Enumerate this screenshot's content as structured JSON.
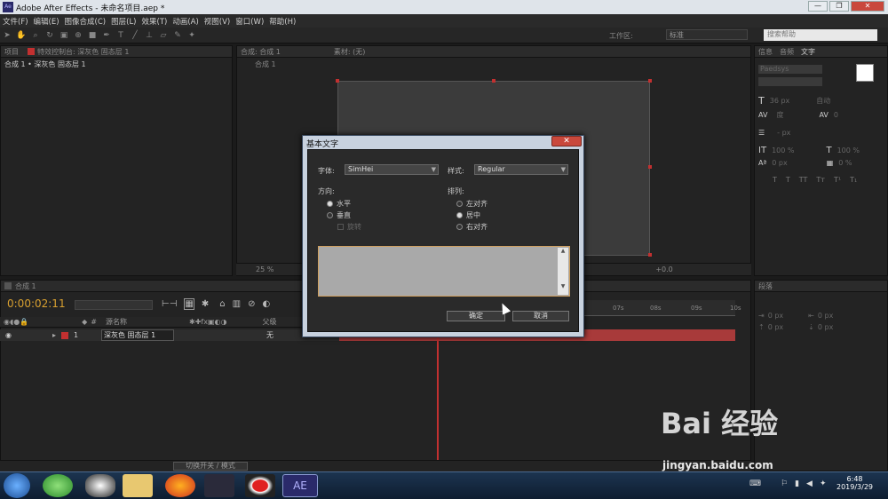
{
  "window": {
    "title": "Adobe After Effects - 未命名项目.aep *",
    "minimize": "—",
    "maximize": "❐",
    "close": "✕"
  },
  "menu": [
    "文件(F)",
    "编辑(E)",
    "图像合成(C)",
    "图层(L)",
    "效果(T)",
    "动画(A)",
    "视图(V)",
    "窗口(W)",
    "帮助(H)"
  ],
  "toolbar": {
    "workspace_label": "工作区:",
    "workspace_value": "标准",
    "search_placeholder": "搜索帮助"
  },
  "project_panel": {
    "tab1": "项目",
    "tab2": "特效控制台: 深灰色 固态层 1",
    "breadcrumb": "合成 1 • 深灰色 固态层 1"
  },
  "comp_panel": {
    "tab1": "合成: 合成 1",
    "tab2": "素材: (无)",
    "comp_label": "合成 1",
    "zoom": "25 %",
    "exposure": "+0.0"
  },
  "right_panel": {
    "tab_info": "信息",
    "tab_audio": "音频",
    "tab_text": "文字",
    "font": "Paedsys",
    "size": "36 px",
    "leading": "自动",
    "tracking_val": "0",
    "indent": "- px",
    "scale_v": "100 %",
    "scale_h": "100 %",
    "baseline": "0 px",
    "tsume": "0 %"
  },
  "paragraph_panel": {
    "tab": "段落",
    "left": "0 px",
    "right": "0 px",
    "top": "0 px",
    "bottom": "0 px"
  },
  "timeline": {
    "tab": "合成 1",
    "timecode": "0:00:02:11",
    "col_name": "源名称",
    "col_parent": "父级",
    "layer_num": "1",
    "layer_name": "深灰色 固态层 1",
    "parent_value": "无",
    "ticks": [
      "07s",
      "08s",
      "09s",
      "10s"
    ],
    "switch_label": "切换开关 / 模式"
  },
  "dialog": {
    "title": "基本文字",
    "close": "✕",
    "font_label": "字体:",
    "font_value": "SimHei",
    "style_label": "样式:",
    "style_value": "Regular",
    "direction_label": "方向:",
    "dir_horizontal": "水平",
    "dir_vertical": "垂直",
    "rotate": "旋转",
    "align_label": "排列:",
    "align_left": "左对齐",
    "align_center": "居中",
    "align_right": "右对齐",
    "ok": "确定",
    "cancel": "取消"
  },
  "taskbar": {
    "ae_label": "AE",
    "time": "6:48",
    "date": "2019/3/29"
  },
  "watermark": {
    "brand": "Bai 经验",
    "url": "jingyan.baidu.com"
  }
}
